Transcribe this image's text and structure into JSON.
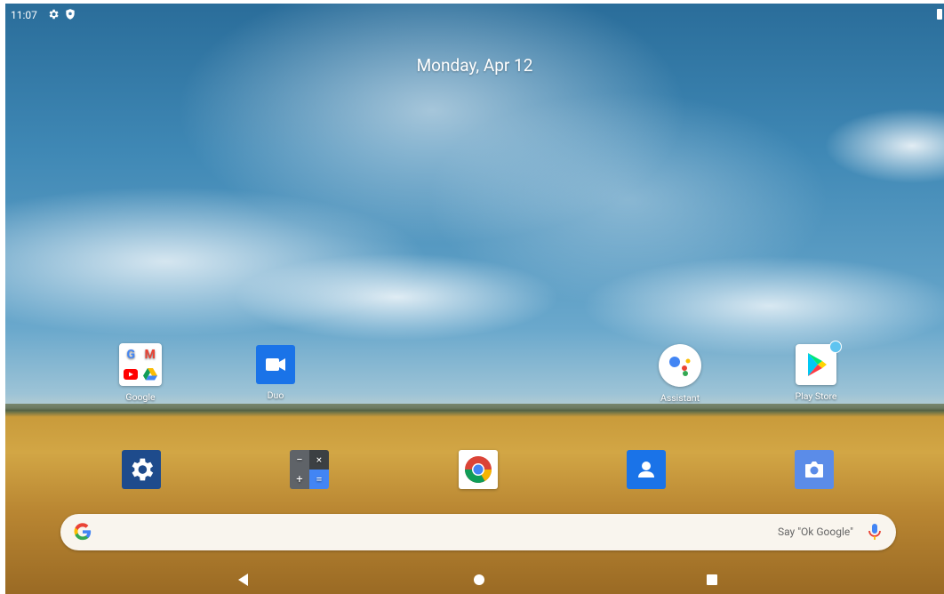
{
  "status_bar": {
    "time": "11:07",
    "icons": [
      "gear-icon",
      "shield-icon"
    ],
    "battery_icon": "battery-icon"
  },
  "date": "Monday, Apr 12",
  "apps_top": [
    {
      "label": "Google",
      "icon": "google-folder-icon"
    },
    {
      "label": "Duo",
      "icon": "duo-icon"
    },
    {
      "label": "Assistant",
      "icon": "assistant-icon"
    },
    {
      "label": "Play Store",
      "icon": "play-store-icon"
    }
  ],
  "dock": [
    {
      "icon": "settings-icon"
    },
    {
      "icon": "calculator-icon"
    },
    {
      "icon": "chrome-icon"
    },
    {
      "icon": "contacts-icon"
    },
    {
      "icon": "camera-icon"
    }
  ],
  "search": {
    "hint": "Say \"Ok Google\""
  },
  "nav": [
    "back-icon",
    "home-icon",
    "recents-icon"
  ],
  "colors": {
    "duo": "#1a73e8",
    "settings": "#1e4b8c",
    "contacts": "#1a73e8",
    "camera": "#5b8ce8",
    "calc_dark": "#5f6368",
    "calc_accent": "#4285f4"
  }
}
